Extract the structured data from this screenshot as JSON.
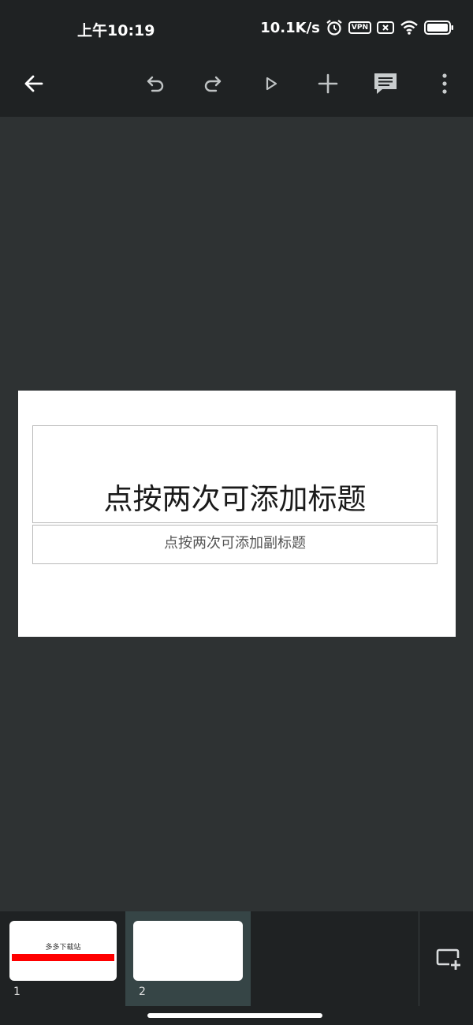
{
  "status_bar": {
    "time": "上午10:19",
    "net_speed": "10.1K/s",
    "vpn_label": "VPN"
  },
  "toolbar": {
    "icons": [
      "back-arrow-icon",
      "undo-icon",
      "redo-icon",
      "play-icon",
      "add-icon",
      "comment-icon",
      "more-vert-icon"
    ]
  },
  "slide": {
    "title_placeholder": "点按两次可添加标题",
    "subtitle_placeholder": "点按两次可添加副标题"
  },
  "filmstrip": {
    "slides": [
      {
        "number": "1",
        "title": "多多下载站"
      },
      {
        "number": "2",
        "title": ""
      }
    ],
    "selected_index": 2
  },
  "colors": {
    "background": "#2e3233",
    "bar": "#1f2223",
    "selected": "#364546",
    "accent_red": "#ff0000"
  }
}
